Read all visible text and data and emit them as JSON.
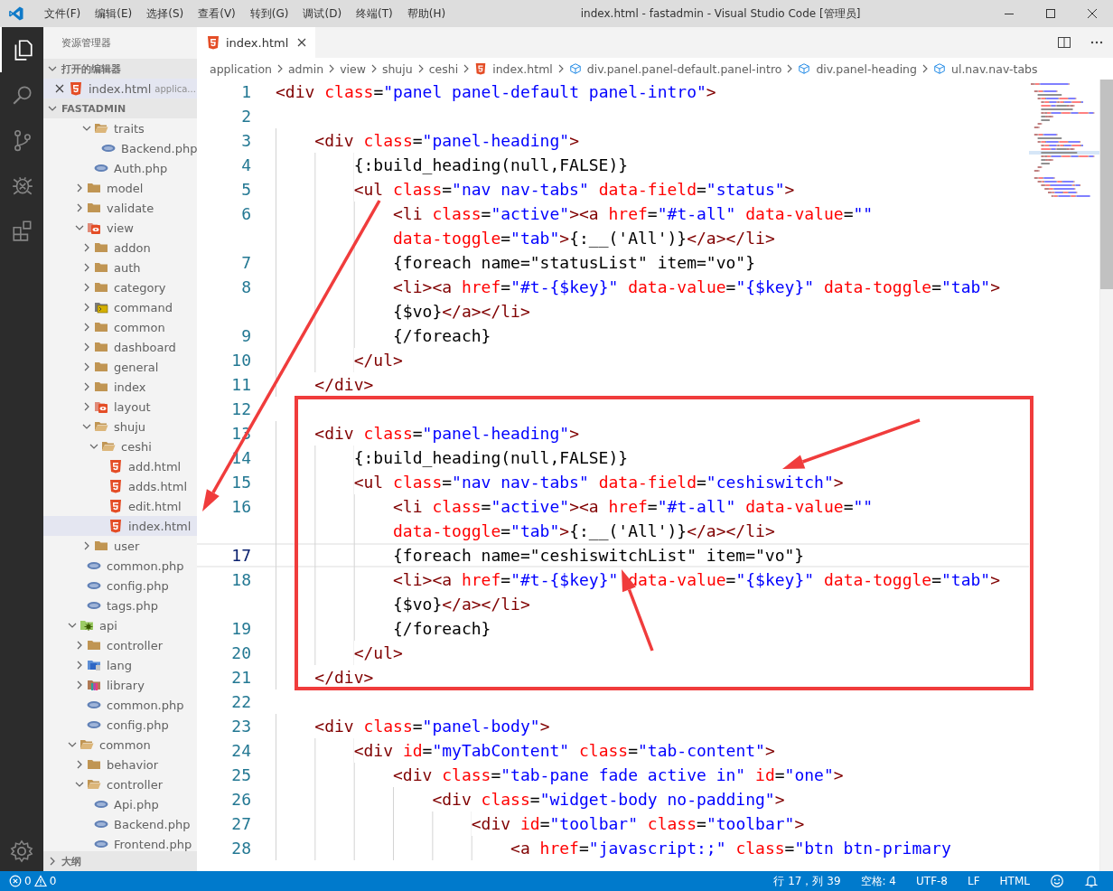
{
  "window": {
    "title": "index.html - fastadmin - Visual Studio Code [管理员]"
  },
  "menu": [
    "文件(F)",
    "编辑(E)",
    "选择(S)",
    "查看(V)",
    "转到(G)",
    "调试(D)",
    "终端(T)",
    "帮助(H)"
  ],
  "activity_bar": [
    {
      "kind": "explorer",
      "selected": true
    },
    {
      "kind": "search",
      "selected": false
    },
    {
      "kind": "source-control",
      "selected": false
    },
    {
      "kind": "debug",
      "selected": false
    },
    {
      "kind": "extensions",
      "selected": false
    }
  ],
  "sidebar": {
    "title": "资源管理器",
    "sections": [
      {
        "label": "打开的编辑器",
        "expanded": true,
        "items": [
          {
            "label": "index.html",
            "description": "applica...",
            "kind": "html",
            "selected": true
          }
        ]
      },
      {
        "label": "FASTADMIN",
        "expanded": true,
        "items": [
          {
            "children": [
              {
                "children": [
                  {
                    "label": "traits",
                    "kind": "folder",
                    "expanded": true,
                    "selected": false,
                    "children": [
                      {
                        "label": "Backend.php",
                        "kind": "php",
                        "selected": false
                      }
                    ]
                  },
                  {
                    "label": "Auth.php",
                    "kind": "php",
                    "selected": false
                  }
                ]
              },
              {
                "label": "model",
                "kind": "folder",
                "expanded": false,
                "selected": false
              },
              {
                "label": "validate",
                "kind": "folder",
                "expanded": false,
                "selected": false
              },
              {
                "label": "view",
                "kind": "view",
                "expanded": true,
                "selected": false,
                "children": [
                  {
                    "label": "addon",
                    "kind": "folder",
                    "expanded": false,
                    "selected": false
                  },
                  {
                    "label": "auth",
                    "kind": "folder",
                    "expanded": false,
                    "selected": false
                  },
                  {
                    "label": "category",
                    "kind": "folder",
                    "expanded": false,
                    "selected": false
                  },
                  {
                    "label": "command",
                    "kind": "command",
                    "expanded": false,
                    "selected": false
                  },
                  {
                    "label": "common",
                    "kind": "folder",
                    "expanded": false,
                    "selected": false
                  },
                  {
                    "label": "dashboard",
                    "kind": "folder",
                    "expanded": false,
                    "selected": false
                  },
                  {
                    "label": "general",
                    "kind": "folder",
                    "expanded": false,
                    "selected": false
                  },
                  {
                    "label": "index",
                    "kind": "folder",
                    "expanded": false,
                    "selected": false
                  },
                  {
                    "label": "layout",
                    "kind": "view",
                    "expanded": false,
                    "selected": false
                  },
                  {
                    "label": "shuju",
                    "kind": "folder",
                    "expanded": true,
                    "selected": false,
                    "children": [
                      {
                        "label": "ceshi",
                        "kind": "folder",
                        "expanded": true,
                        "selected": false,
                        "children": [
                          {
                            "label": "add.html",
                            "kind": "html",
                            "selected": false
                          },
                          {
                            "label": "adds.html",
                            "kind": "html",
                            "selected": false
                          },
                          {
                            "label": "edit.html",
                            "kind": "html",
                            "selected": false
                          },
                          {
                            "label": "index.html",
                            "kind": "html",
                            "selected": true
                          }
                        ]
                      }
                    ]
                  },
                  {
                    "label": "user",
                    "kind": "folder",
                    "expanded": false,
                    "selected": false
                  }
                ]
              },
              {
                "label": "common.php",
                "kind": "php",
                "selected": false
              },
              {
                "label": "config.php",
                "kind": "php",
                "selected": false
              },
              {
                "label": "tags.php",
                "kind": "php",
                "selected": false
              }
            ]
          },
          {
            "label": "api",
            "kind": "api",
            "expanded": true,
            "selected": false,
            "children": [
              {
                "label": "controller",
                "kind": "folder",
                "expanded": false,
                "selected": false
              },
              {
                "label": "lang",
                "kind": "lang",
                "expanded": false,
                "selected": false
              },
              {
                "label": "library",
                "kind": "library",
                "expanded": false,
                "selected": false
              },
              {
                "label": "common.php",
                "kind": "php",
                "selected": false
              },
              {
                "label": "config.php",
                "kind": "php",
                "selected": false
              }
            ]
          },
          {
            "label": "common",
            "kind": "folder",
            "expanded": true,
            "selected": false,
            "children": [
              {
                "label": "behavior",
                "kind": "folder",
                "expanded": false,
                "selected": false
              },
              {
                "label": "controller",
                "kind": "folder",
                "expanded": true,
                "selected": false,
                "children": [
                  {
                    "label": "Api.php",
                    "kind": "php",
                    "selected": false
                  },
                  {
                    "label": "Backend.php",
                    "kind": "php",
                    "selected": false
                  },
                  {
                    "label": "Frontend.php",
                    "kind": "php",
                    "selected": false
                  }
                ]
              }
            ]
          }
        ]
      },
      {
        "label": "大纲",
        "expanded": false
      }
    ]
  },
  "tabs": [
    {
      "label": "index.html",
      "kind": "html",
      "selected": true
    }
  ],
  "breadcrumb": [
    {
      "label": "application"
    },
    {
      "label": "admin"
    },
    {
      "label": "view"
    },
    {
      "label": "shuju"
    },
    {
      "label": "ceshi"
    },
    {
      "label": "index.html",
      "kind": "html"
    },
    {
      "label": "div.panel.panel-default.panel-intro",
      "kind": "element"
    },
    {
      "label": "div.panel-heading",
      "kind": "element"
    },
    {
      "label": "ul.nav.nav-tabs",
      "kind": "element"
    }
  ],
  "editor": {
    "rows": [
      {
        "number": "1",
        "text": "<div class=\"panel panel-default panel-intro\">",
        "current": false
      },
      {
        "number": "2",
        "current": false
      },
      {
        "number": "3",
        "text": "    <div class=\"panel-heading\">",
        "current": false
      },
      {
        "number": "4",
        "text": "        {:build_heading(null,FALSE)}",
        "current": false
      },
      {
        "number": "5",
        "text": "        <ul class=\"nav nav-tabs\" data-field=\"status\">",
        "current": false
      },
      {
        "number": "6",
        "text": "            <li class=\"active\"><a href=\"#t-all\" data-value=\"\"",
        "current": false
      },
      {
        "text": "            data-toggle=\"tab\">{:__('All')}</a></li>"
      },
      {
        "number": "7",
        "text": "            {foreach name=\"statusList\" item=\"vo\"}",
        "current": false
      },
      {
        "number": "8",
        "text": "            <li><a href=\"#t-{$key}\" data-value=\"{$key}\" data-toggle=\"tab\">",
        "current": false
      },
      {
        "text": "            {$vo}</a></li>"
      },
      {
        "number": "9",
        "text": "            {/foreach}",
        "current": false
      },
      {
        "number": "10",
        "text": "        </ul>",
        "current": false
      },
      {
        "number": "11",
        "text": "    </div>",
        "current": false
      },
      {
        "number": "12",
        "current": false
      },
      {
        "number": "13",
        "text": "    <div class=\"panel-heading\">",
        "current": false
      },
      {
        "number": "14",
        "text": "        {:build_heading(null,FALSE)}",
        "current": false
      },
      {
        "number": "15",
        "text": "        <ul class=\"nav nav-tabs\" data-field=\"ceshiswitch\">",
        "current": false
      },
      {
        "number": "16",
        "text": "            <li class=\"active\"><a href=\"#t-all\" data-value=\"\"",
        "current": false
      },
      {
        "text": "            data-toggle=\"tab\">{:__('All')}</a></li>"
      },
      {
        "number": "17",
        "text": "            {foreach name=\"ceshiswitchList\" item=\"vo\"}",
        "current": true
      },
      {
        "number": "18",
        "text": "            <li><a href=\"#t-{$key}\" data-value=\"{$key}\" data-toggle=\"tab\">",
        "current": false
      },
      {
        "text": "            {$vo}</a></li>"
      },
      {
        "number": "19",
        "text": "            {/foreach}",
        "current": false
      },
      {
        "number": "20",
        "text": "        </ul>",
        "current": false
      },
      {
        "number": "21",
        "text": "    </div>",
        "current": false
      },
      {
        "number": "22",
        "current": false
      },
      {
        "number": "23",
        "text": "    <div class=\"panel-body\">",
        "current": false
      },
      {
        "number": "24",
        "text": "        <div id=\"myTabContent\" class=\"tab-content\">",
        "current": false
      },
      {
        "number": "25",
        "text": "            <div class=\"tab-pane fade active in\" id=\"one\">",
        "current": false
      },
      {
        "number": "26",
        "text": "                <div class=\"widget-body no-padding\">",
        "current": false
      },
      {
        "number": "27",
        "text": "                    <div id=\"toolbar\" class=\"toolbar\">",
        "current": false
      },
      {
        "number": "28",
        "text": "                        <a href=\"javascript:;\" class=\"btn btn-primary",
        "current": false
      }
    ]
  },
  "annotations": [
    {
      "kind": "box"
    },
    {
      "kind": "arrow"
    },
    {
      "kind": "arrow"
    },
    {
      "kind": "arrow"
    }
  ],
  "status_bar": {
    "errors": "0",
    "warnings": "0",
    "items": [
      "行 17，列 39",
      "空格: 4",
      "UTF-8",
      "LF",
      "HTML"
    ]
  }
}
